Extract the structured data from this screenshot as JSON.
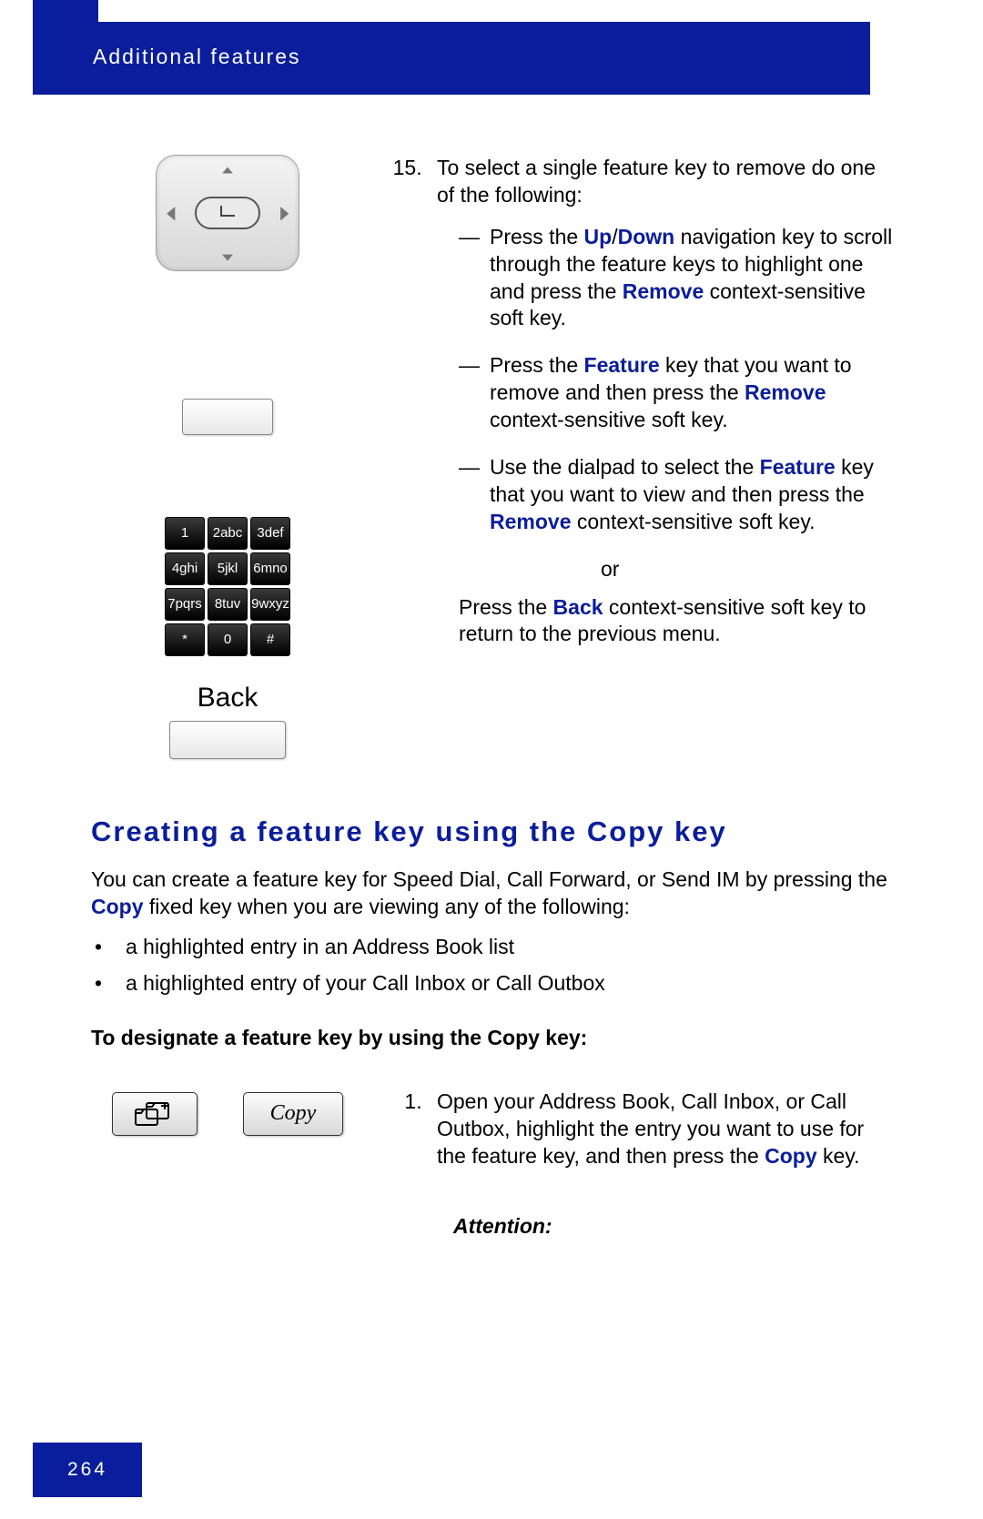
{
  "header": {
    "title": "Additional features"
  },
  "footer": {
    "page_number": "264"
  },
  "step15": {
    "number": "15.",
    "lead": "To select a single feature key to remove do one of the following:",
    "items": [
      {
        "pre": "Press the ",
        "k1": "Up",
        "sep": "/",
        "k2": "Down",
        "mid": " navigation key to scroll through the feature keys to highlight one and press the ",
        "k3": "Remove",
        "post": " context-sensitive soft key."
      },
      {
        "pre": "Press the ",
        "k1": "Feature",
        "mid": " key that you want to remove and then press the ",
        "k2": "Remove",
        "post": " context-sensitive soft key."
      },
      {
        "pre": "Use the dialpad to select the ",
        "k1": "Feature",
        "mid": " key that you want to view and then press the ",
        "k2": "Remove",
        "post": " context-sensitive soft key."
      }
    ],
    "or": "or",
    "back_line_pre": "Press the ",
    "back_kw": "Back",
    "back_line_post": " context-sensitive soft key to return to the previous menu.",
    "back_label": "Back"
  },
  "dialpad": [
    "1",
    "2abc",
    "3def",
    "4ghi",
    "5jkl",
    "6mno",
    "7pqrs",
    "8tuv",
    "9wxyz",
    "*",
    "0",
    "#"
  ],
  "section": {
    "heading": "Creating a feature key using the Copy key",
    "intro_pre": "You can create a feature key for Speed Dial, Call Forward, or Send IM by pressing the ",
    "intro_kw": "Copy",
    "intro_post": " fixed key when you are viewing any of the following:",
    "bullets": [
      "a highlighted entry in an Address Book list",
      "a highlighted entry of your Call Inbox or Call Outbox"
    ],
    "subhead": "To designate a feature key by using the Copy key:"
  },
  "copy_btn_label": "Copy",
  "step1": {
    "number": "1.",
    "pre": "Open your Address Book, Call Inbox, or Call Outbox, highlight the entry you want to use for the feature key, and then press the ",
    "kw": "Copy",
    "post": " key."
  },
  "attention": "Attention:"
}
